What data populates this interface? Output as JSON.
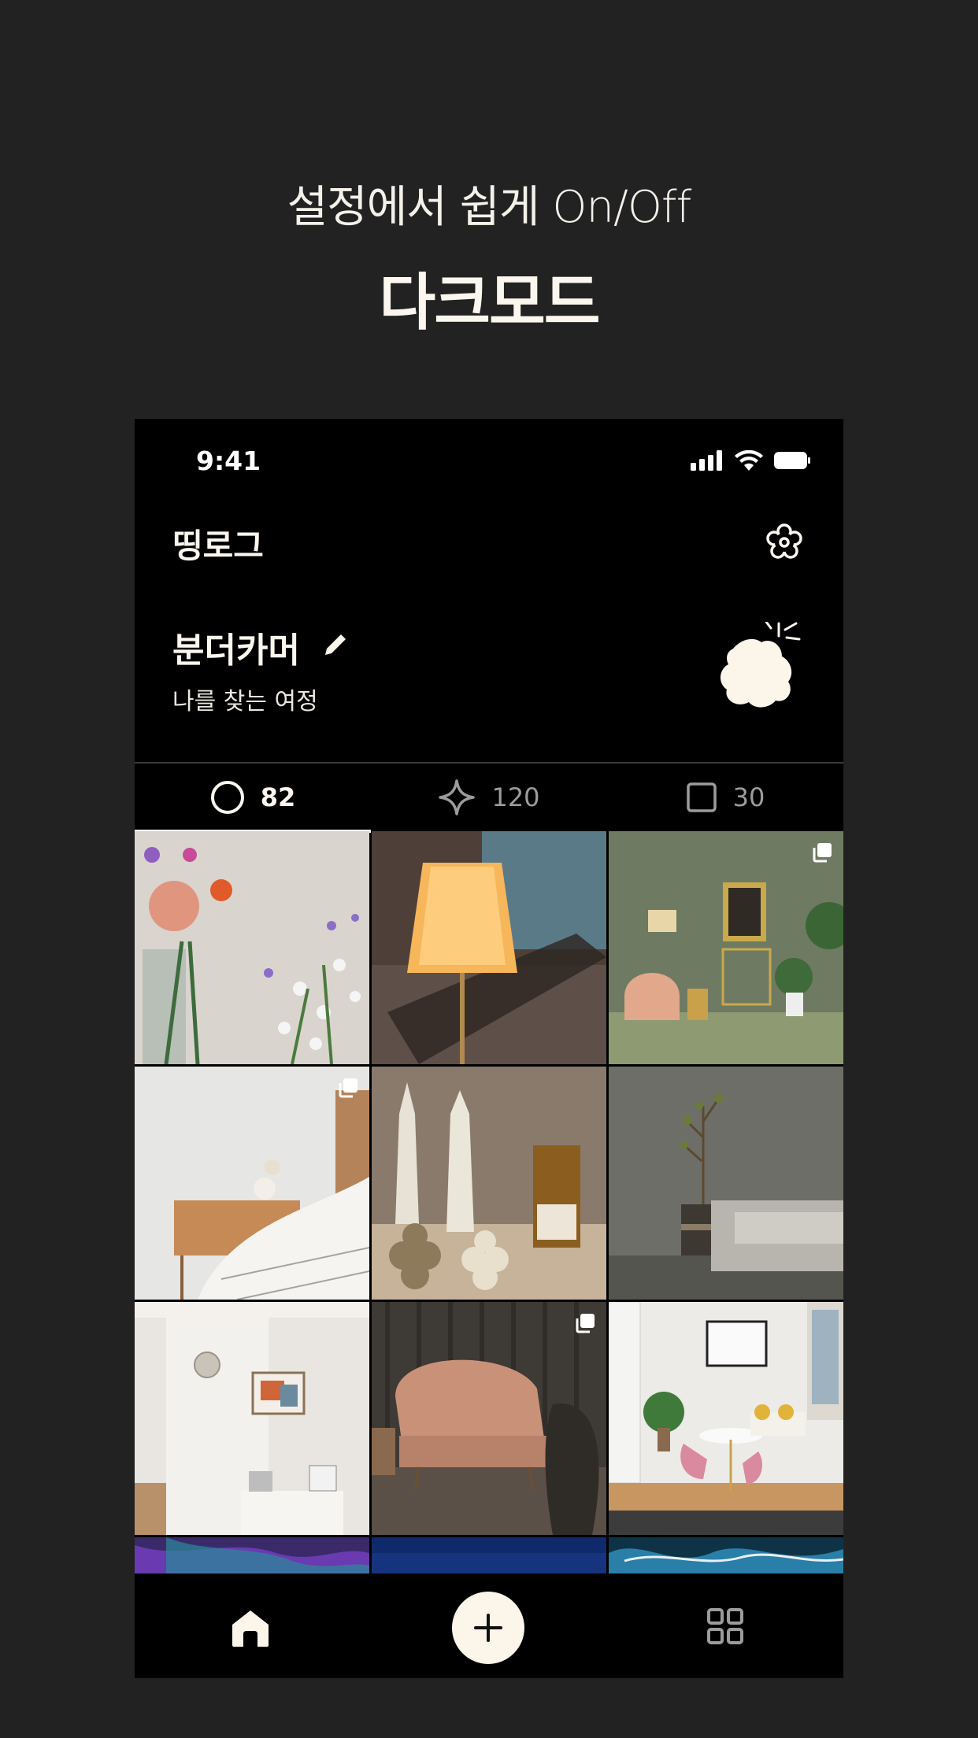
{
  "promo": {
    "subtitle": "설정에서 쉽게 On/Off",
    "title": "다크모드"
  },
  "status_bar": {
    "time": "9:41",
    "icons": [
      "signal-icon",
      "wifi-icon",
      "battery-icon"
    ]
  },
  "header": {
    "app_title": "띵로그",
    "settings_icon": "gear-icon"
  },
  "profile": {
    "name": "분더카머",
    "subtitle": "나를 찾는 여정",
    "edit_icon": "pencil-icon",
    "avatar_icon": "blob-sparkle-icon"
  },
  "tabs": [
    {
      "icon": "circle-icon",
      "count": "82",
      "active": true
    },
    {
      "icon": "sparkle-icon",
      "count": "120",
      "active": false
    },
    {
      "icon": "square-icon",
      "count": "30",
      "active": false
    }
  ],
  "grid": [
    {
      "subject": "flowers",
      "multi": false
    },
    {
      "subject": "lamp",
      "multi": false
    },
    {
      "subject": "green-room",
      "multi": true
    },
    {
      "subject": "bedroom",
      "multi": true
    },
    {
      "subject": "candles",
      "multi": false
    },
    {
      "subject": "plant-sofa",
      "multi": false
    },
    {
      "subject": "white-room",
      "multi": false
    },
    {
      "subject": "pink-sofa",
      "multi": true
    },
    {
      "subject": "dining-room",
      "multi": false
    },
    {
      "subject": "purple-abstract",
      "multi": false
    },
    {
      "subject": "blue-dark",
      "multi": false
    },
    {
      "subject": "blue-marble",
      "multi": false
    }
  ],
  "bottom_nav": {
    "home_icon": "home-icon",
    "add_icon": "plus-icon",
    "grid_icon": "grid-icon"
  },
  "colors": {
    "background": "#222222",
    "phone": "#000000",
    "cream": "#fbf5ea",
    "inactive": "#9c9c9c"
  }
}
